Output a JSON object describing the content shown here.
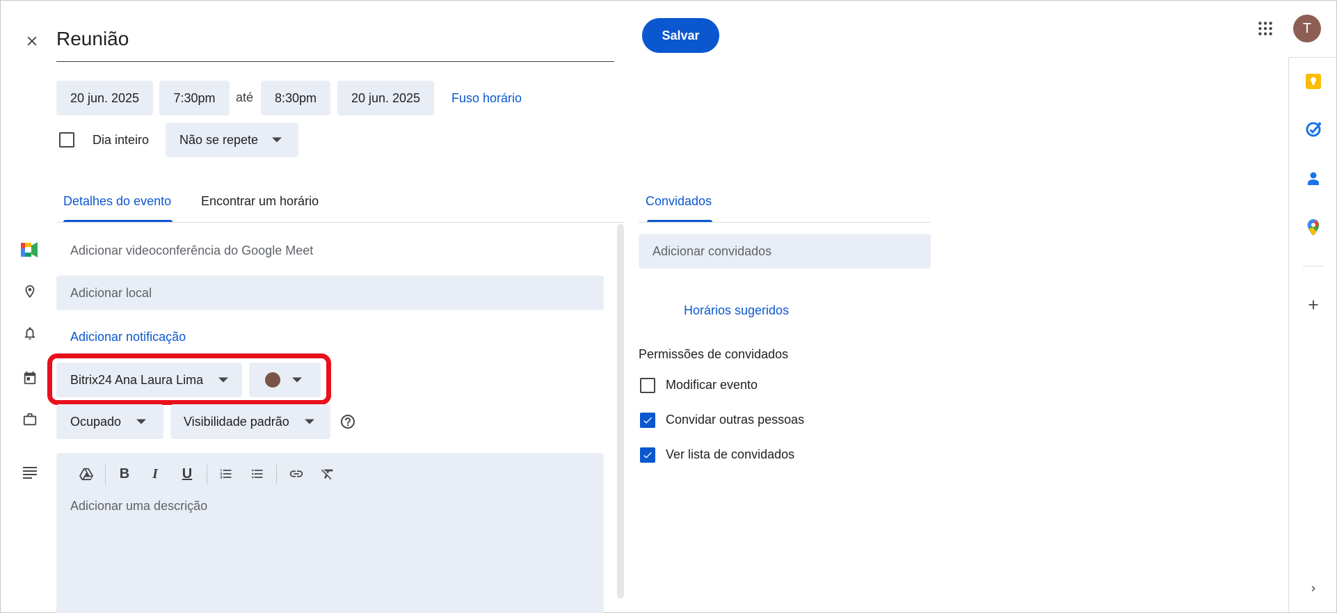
{
  "header": {
    "title": "Reunião",
    "save_label": "Salvar",
    "avatar_letter": "T"
  },
  "datetime": {
    "start_date": "20 jun. 2025",
    "start_time": "7:30pm",
    "separator": "até",
    "end_time": "8:30pm",
    "end_date": "20 jun. 2025",
    "timezone_link": "Fuso horário",
    "all_day_label": "Dia inteiro",
    "all_day_checked": false,
    "repeat_value": "Não se repete"
  },
  "tabs": {
    "details": "Detalhes do evento",
    "find_time": "Encontrar um horário",
    "guests": "Convidados"
  },
  "details": {
    "meet_placeholder": "Adicionar videoconferência do Google Meet",
    "location_placeholder": "Adicionar local",
    "add_notification": "Adicionar notificação",
    "calendar_value": "Bitrix24 Ana Laura Lima",
    "event_color": "#795548",
    "availability_value": "Ocupado",
    "visibility_value": "Visibilidade padrão",
    "description_placeholder": "Adicionar uma descrição",
    "toolbar": [
      "drive-icon",
      "bold-icon",
      "italic-icon",
      "underline-icon",
      "numbered-list-icon",
      "bulleted-list-icon",
      "link-icon",
      "clear-formatting-icon"
    ]
  },
  "guests": {
    "add_guests_placeholder": "Adicionar convidados",
    "suggested_times": "Horários sugeridos",
    "permissions_title": "Permissões de convidados",
    "permissions": [
      {
        "label": "Modificar evento",
        "checked": false
      },
      {
        "label": "Convidar outras pessoas",
        "checked": true
      },
      {
        "label": "Ver lista de convidados",
        "checked": true
      }
    ]
  },
  "side_panel": {
    "icons": [
      "keep-icon",
      "tasks-icon",
      "contacts-icon",
      "maps-icon",
      "add-icon"
    ]
  },
  "colors": {
    "accent": "#0b57d0",
    "field_bg": "#e9eef6",
    "highlight": "#e8101c"
  }
}
